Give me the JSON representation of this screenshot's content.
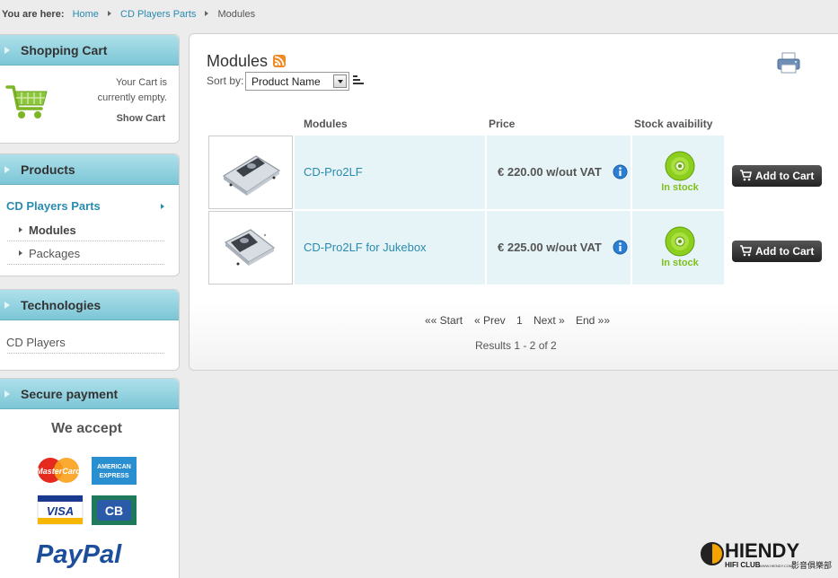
{
  "breadcrumb": {
    "label": "You are here:",
    "items": [
      "Home",
      "CD Players Parts",
      "Modules"
    ]
  },
  "cart": {
    "title": "Shopping Cart",
    "line1": "Your Cart is",
    "line2": "currently empty.",
    "show_cart": "Show Cart"
  },
  "products": {
    "title": "Products",
    "category": "CD Players Parts",
    "sub_items": [
      "Modules",
      "Packages"
    ]
  },
  "technologies": {
    "title": "Technologies",
    "items": [
      "CD Players"
    ]
  },
  "payment": {
    "title": "Secure payment",
    "we_accept": "We accept",
    "logos": [
      "MasterCard",
      "AMERICAN",
      "EXPRESS",
      "VISA",
      "CB",
      "PayPal"
    ]
  },
  "main": {
    "title": "Modules",
    "sort_label": "Sort by:",
    "sort_value": "Product Name",
    "columns": [
      "Modules",
      "Price",
      "Stock avaibility"
    ],
    "rows": [
      {
        "name": "CD-Pro2LF",
        "price": "€ 220.00 w/out VAT",
        "stock": "In stock",
        "button": "Add to Cart"
      },
      {
        "name": "CD-Pro2LF for Jukebox",
        "price": "€ 225.00 w/out VAT",
        "stock": "In stock",
        "button": "Add to Cart"
      }
    ],
    "pager": {
      "start": "«« Start",
      "prev": "« Prev",
      "page": "1",
      "next": "Next »",
      "end": "End »»"
    },
    "results": "Results 1 - 2 of 2"
  },
  "watermark": {
    "name": "HIENDY",
    "sub": "HIFI CLUB",
    "url": "WWW.HIENDY.COM",
    "chinese": "影音俱樂部"
  },
  "colors": {
    "accent": "#2a8bb0",
    "header": "#7cc6d6",
    "stock": "#7fbf1a",
    "button": "#333333"
  }
}
